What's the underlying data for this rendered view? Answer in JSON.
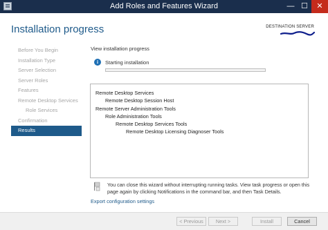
{
  "window": {
    "title": "Add Roles and Features Wizard",
    "controls": {
      "minimize": "—",
      "maximize": "☐",
      "close": "✕"
    }
  },
  "header": {
    "page_title": "Installation progress",
    "destination_server_label": "DESTINATION SERVER"
  },
  "sidebar": {
    "items": [
      {
        "label": "Before You Begin",
        "state": "disabled"
      },
      {
        "label": "Installation Type",
        "state": "disabled"
      },
      {
        "label": "Server Selection",
        "state": "disabled"
      },
      {
        "label": "Server Roles",
        "state": "disabled"
      },
      {
        "label": "Features",
        "state": "disabled"
      },
      {
        "label": "Remote Desktop Services",
        "state": "disabled"
      },
      {
        "label": "Role Services",
        "state": "disabled"
      },
      {
        "label": "Confirmation",
        "state": "disabled"
      },
      {
        "label": "Results",
        "state": "active"
      }
    ]
  },
  "main": {
    "section_label": "View installation progress",
    "status_icon": "info-icon",
    "status_text": "Starting installation",
    "progress": 0,
    "results_tree": [
      {
        "label": "Remote Desktop Services",
        "level": 0
      },
      {
        "label": "Remote Desktop Session Host",
        "level": 1
      },
      {
        "label": "Remote Server Administration Tools",
        "level": 0
      },
      {
        "label": "Role Administration Tools",
        "level": 1
      },
      {
        "label": "Remote Desktop Services Tools",
        "level": 2
      },
      {
        "label": "Remote Desktop Licensing Diagnoser Tools",
        "level": 3
      }
    ],
    "notice_icon": "flag-icon",
    "notice_text": "You can close this wizard without interrupting running tasks. View task progress or open this page again by clicking Notifications in the command bar, and then Task Details.",
    "export_link": "Export configuration settings"
  },
  "footer": {
    "previous": "< Previous",
    "next": "Next >",
    "install": "Install",
    "cancel": "Cancel"
  },
  "colors": {
    "title_bar": "#1a2e4c",
    "accent": "#1e5a8a",
    "close_button": "#c42b1c",
    "progress_fill": "#06b025"
  }
}
